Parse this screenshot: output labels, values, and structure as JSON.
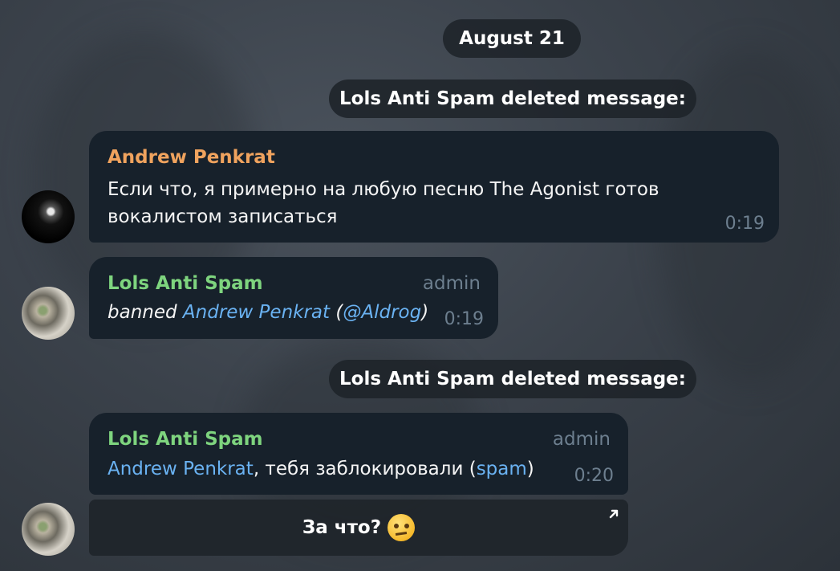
{
  "date_pill": "August 21",
  "service_messages": [
    "Lols Anti Spam deleted message:",
    "Lols Anti Spam deleted message:"
  ],
  "messages": [
    {
      "sender": "Andrew Penkrat",
      "sender_color": "#f0a35e",
      "line1": "Если что, я примерно на любую песню The Agonist готов",
      "line2": "вокалистом записаться",
      "time": "0:19"
    },
    {
      "sender": "Lols Anti Spam",
      "sender_color": "#7ed47e",
      "role": "admin",
      "prefix": "banned ",
      "mention": "Andrew Penkrat",
      "open_paren": " (",
      "username": "@Aldrog",
      "close_paren": ")",
      "time": "0:19"
    },
    {
      "sender": "Lols Anti Spam",
      "sender_color": "#7ed47e",
      "role": "admin",
      "mention": "Andrew Penkrat",
      "middle": ", тебя заблокировали (",
      "reason": "spam",
      "close_paren": ")",
      "time": "0:20",
      "button_label": "За что?",
      "button_icon": "arrow-up-right-icon"
    }
  ]
}
